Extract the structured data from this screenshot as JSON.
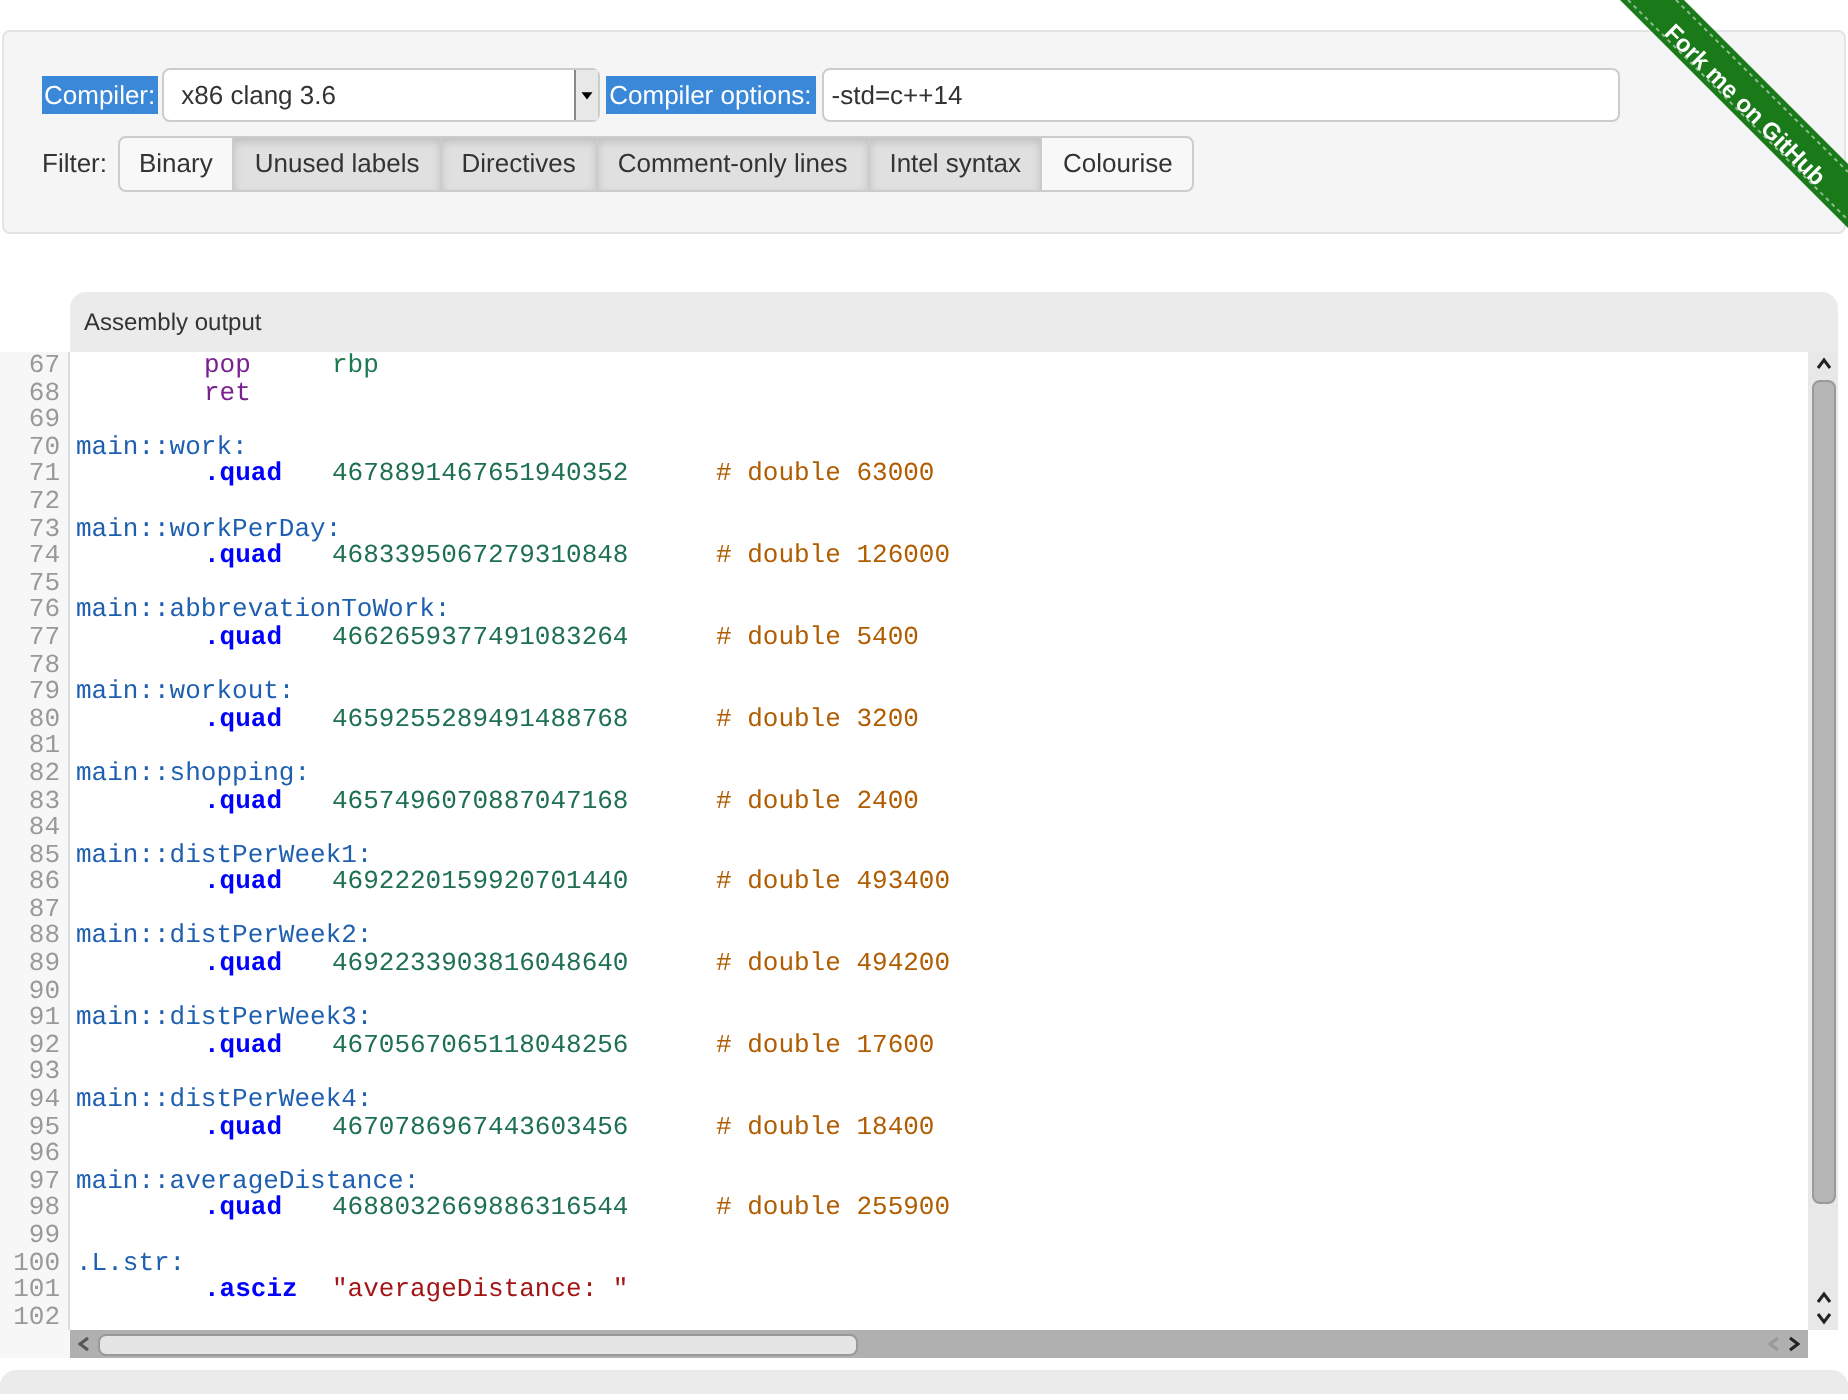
{
  "compiler": {
    "label": "Compiler:",
    "value": "x86 clang 3.6",
    "options_label": "Compiler options:",
    "options_value": "-std=c++14"
  },
  "filter": {
    "label": "Filter:",
    "buttons": [
      {
        "label": "Binary",
        "selected": false
      },
      {
        "label": "Unused labels",
        "selected": true
      },
      {
        "label": "Directives",
        "selected": true
      },
      {
        "label": "Comment-only lines",
        "selected": true
      },
      {
        "label": "Intel syntax",
        "selected": true
      },
      {
        "label": "Colourise",
        "selected": false
      }
    ]
  },
  "ribbon": "Fork me on GitHub",
  "output": {
    "title": "Assembly output",
    "lines": [
      {
        "number": "67",
        "tokens": [
          {
            "kind": "instruction",
            "text": "pop"
          },
          {
            "kind": "register",
            "text": "rbp"
          }
        ]
      },
      {
        "number": "68",
        "tokens": [
          {
            "kind": "instruction",
            "text": "ret"
          }
        ]
      },
      {
        "number": "69"
      },
      {
        "number": "70",
        "tokens": [
          {
            "kind": "label",
            "text": "main::work:"
          }
        ]
      },
      {
        "number": "71",
        "tokens": [
          {
            "kind": "directive",
            "text": ".quad"
          },
          {
            "kind": "number",
            "text": "4678891467651940352"
          },
          {
            "kind": "comment",
            "text": "# double 63000"
          }
        ]
      },
      {
        "number": "72"
      },
      {
        "number": "73",
        "tokens": [
          {
            "kind": "label",
            "text": "main::workPerDay:"
          }
        ]
      },
      {
        "number": "74",
        "tokens": [
          {
            "kind": "directive",
            "text": ".quad"
          },
          {
            "kind": "number",
            "text": "4683395067279310848"
          },
          {
            "kind": "comment",
            "text": "# double 126000"
          }
        ]
      },
      {
        "number": "75"
      },
      {
        "number": "76",
        "tokens": [
          {
            "kind": "label",
            "text": "main::abbrevationToWork:"
          }
        ]
      },
      {
        "number": "77",
        "tokens": [
          {
            "kind": "directive",
            "text": ".quad"
          },
          {
            "kind": "number",
            "text": "4662659377491083264"
          },
          {
            "kind": "comment",
            "text": "# double 5400"
          }
        ]
      },
      {
        "number": "78"
      },
      {
        "number": "79",
        "tokens": [
          {
            "kind": "label",
            "text": "main::workout:"
          }
        ]
      },
      {
        "number": "80",
        "tokens": [
          {
            "kind": "directive",
            "text": ".quad"
          },
          {
            "kind": "number",
            "text": "4659255289491488768"
          },
          {
            "kind": "comment",
            "text": "# double 3200"
          }
        ]
      },
      {
        "number": "81"
      },
      {
        "number": "82",
        "tokens": [
          {
            "kind": "label",
            "text": "main::shopping:"
          }
        ]
      },
      {
        "number": "83",
        "tokens": [
          {
            "kind": "directive",
            "text": ".quad"
          },
          {
            "kind": "number",
            "text": "4657496070887047168"
          },
          {
            "kind": "comment",
            "text": "# double 2400"
          }
        ]
      },
      {
        "number": "84"
      },
      {
        "number": "85",
        "tokens": [
          {
            "kind": "label",
            "text": "main::distPerWeek1:"
          }
        ]
      },
      {
        "number": "86",
        "tokens": [
          {
            "kind": "directive",
            "text": ".quad"
          },
          {
            "kind": "number",
            "text": "4692220159920701440"
          },
          {
            "kind": "comment",
            "text": "# double 493400"
          }
        ]
      },
      {
        "number": "87"
      },
      {
        "number": "88",
        "tokens": [
          {
            "kind": "label",
            "text": "main::distPerWeek2:"
          }
        ]
      },
      {
        "number": "89",
        "tokens": [
          {
            "kind": "directive",
            "text": ".quad"
          },
          {
            "kind": "number",
            "text": "4692233903816048640"
          },
          {
            "kind": "comment",
            "text": "# double 494200"
          }
        ]
      },
      {
        "number": "90"
      },
      {
        "number": "91",
        "tokens": [
          {
            "kind": "label",
            "text": "main::distPerWeek3:"
          }
        ]
      },
      {
        "number": "92",
        "tokens": [
          {
            "kind": "directive",
            "text": ".quad"
          },
          {
            "kind": "number",
            "text": "4670567065118048256"
          },
          {
            "kind": "comment",
            "text": "# double 17600"
          }
        ]
      },
      {
        "number": "93"
      },
      {
        "number": "94",
        "tokens": [
          {
            "kind": "label",
            "text": "main::distPerWeek4:"
          }
        ]
      },
      {
        "number": "95",
        "tokens": [
          {
            "kind": "directive",
            "text": ".quad"
          },
          {
            "kind": "number",
            "text": "4670786967443603456"
          },
          {
            "kind": "comment",
            "text": "# double 18400"
          }
        ]
      },
      {
        "number": "96"
      },
      {
        "number": "97",
        "tokens": [
          {
            "kind": "label",
            "text": "main::averageDistance:"
          }
        ]
      },
      {
        "number": "98",
        "tokens": [
          {
            "kind": "directive",
            "text": ".quad"
          },
          {
            "kind": "number",
            "text": "4688032669886316544"
          },
          {
            "kind": "comment",
            "text": "# double 255900"
          }
        ]
      },
      {
        "number": "99"
      },
      {
        "number": "100",
        "tokens": [
          {
            "kind": "label",
            "text": ".L.str:"
          }
        ]
      },
      {
        "number": "101",
        "tokens": [
          {
            "kind": "directive",
            "text": ".asciz"
          },
          {
            "kind": "string",
            "text": "\"averageDistance: \""
          }
        ]
      },
      {
        "number": "102"
      }
    ]
  }
}
